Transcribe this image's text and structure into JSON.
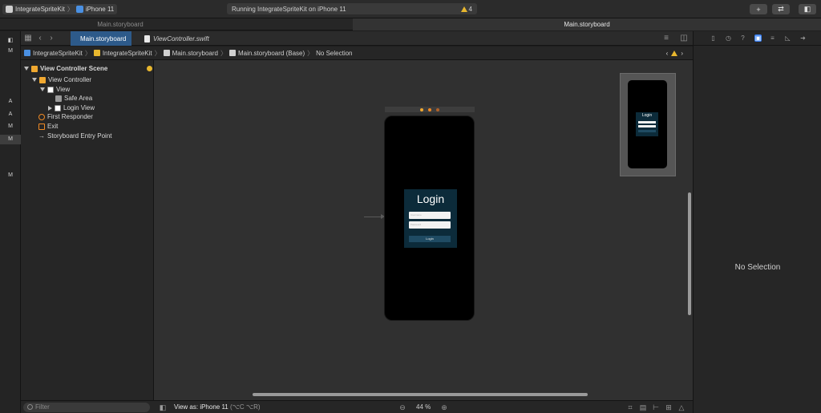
{
  "toolbar": {
    "scheme_name": "IntegrateSpriteKit",
    "separator": "〉",
    "device_name": "iPhone 11",
    "activity_text": "Running IntegrateSpriteKit on iPhone 11",
    "warning_count": "4",
    "library_button": "+",
    "review_button": "⇄",
    "panel_button": "◧"
  },
  "tabs": [
    {
      "label": "Main.storyboard"
    },
    {
      "label": "Main.storyboard"
    }
  ],
  "gutter": [
    "A",
    "A",
    "M",
    "M",
    "M"
  ],
  "editor_tabs": [
    {
      "label": "Main.storyboard"
    },
    {
      "label": "ViewController.swift"
    }
  ],
  "breadcrumb": [
    "IntegrateSpriteKit",
    "IntegrateSpriteKit",
    "Main.storyboard",
    "Main.storyboard (Base)",
    "No Selection"
  ],
  "breadcrumb_sep": "〉",
  "outline": {
    "scene": "View Controller Scene",
    "view_controller": "View Controller",
    "view": "View",
    "safe_area": "Safe Area",
    "login_view": "Login View",
    "first_responder": "First Responder",
    "exit": "Exit",
    "entry_point": "Storyboard Entry Point",
    "entry_arrow": "→"
  },
  "filter": {
    "placeholder": "Filter"
  },
  "canvas": {
    "login_title": "Login",
    "username_placeholder": "Username",
    "password_placeholder": "Password",
    "login_button": "Login",
    "mini_title": "Login"
  },
  "bottombar": {
    "view_as_label": "View as: iPhone 11",
    "view_as_shortcut": "(⌥C ⌥R)",
    "zoom_minus": "⊖",
    "zoom": "44 %",
    "zoom_plus": "⊕"
  },
  "inspector": {
    "no_selection": "No Selection"
  },
  "colors": {
    "accent": "#2d5a8a",
    "warning": "#e8b72e",
    "login_bg": "#0c2b3a"
  }
}
